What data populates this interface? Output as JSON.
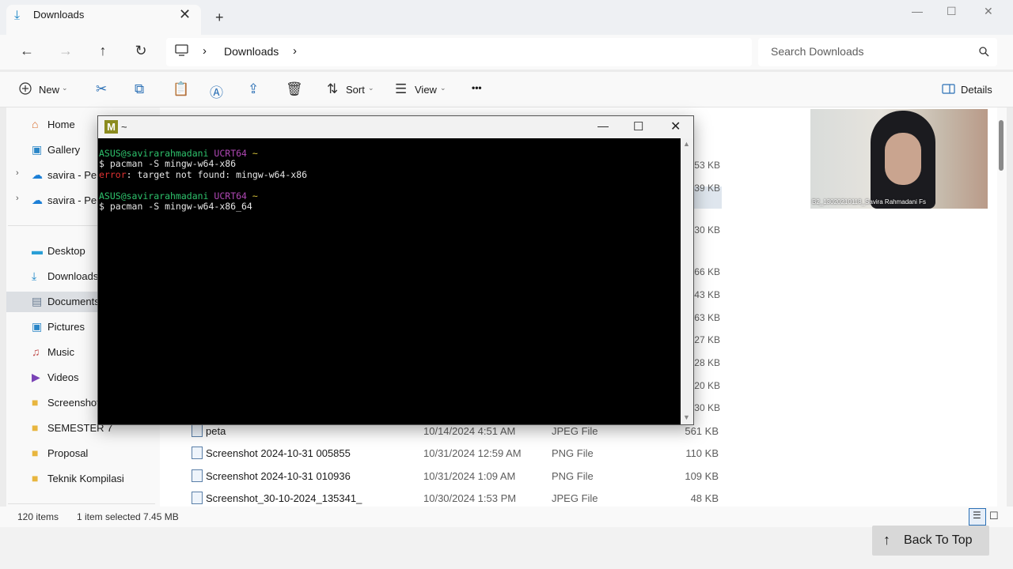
{
  "tab": {
    "title": "Downloads",
    "close": "✕",
    "add": "+"
  },
  "window_controls": {
    "minimize": "—",
    "maximize": "☐",
    "close": "✕"
  },
  "address": {
    "path_item": "Downloads",
    "sep1": "›",
    "sep2": "›"
  },
  "search": {
    "placeholder": "Search Downloads"
  },
  "toolbar": {
    "new_label": "New",
    "sort_label": "Sort",
    "view_label": "View",
    "details_label": "Details",
    "more": "•••"
  },
  "sidebar": {
    "items": [
      {
        "label": "Home"
      },
      {
        "label": "Gallery"
      },
      {
        "label": "savira - Pers"
      },
      {
        "label": "savira - Pers"
      },
      {
        "label": "Desktop"
      },
      {
        "label": "Downloads"
      },
      {
        "label": "Documents"
      },
      {
        "label": "Pictures"
      },
      {
        "label": "Music"
      },
      {
        "label": "Videos"
      },
      {
        "label": "Screenshots"
      },
      {
        "label": "SEMESTER 7"
      },
      {
        "label": "Proposal"
      },
      {
        "label": "Teknik Kompilasi"
      }
    ]
  },
  "partial_sizes": [
    "53 KB",
    "39 KB",
    "30 KB",
    "66 KB",
    "43 KB",
    "63 KB",
    "27 KB",
    "28 KB",
    "20 KB",
    "30 KB"
  ],
  "files": [
    {
      "name": "peta",
      "date": "10/14/2024 4:51 AM",
      "type": "JPEG File",
      "size": "561 KB"
    },
    {
      "name": "Screenshot 2024-10-31 005855",
      "date": "10/31/2024 12:59 AM",
      "type": "PNG File",
      "size": "110 KB"
    },
    {
      "name": "Screenshot 2024-10-31 010936",
      "date": "10/31/2024 1:09 AM",
      "type": "PNG File",
      "size": "109 KB"
    },
    {
      "name": "Screenshot_30-10-2024_135341_",
      "date": "10/30/2024 1:53 PM",
      "type": "JPEG File",
      "size": "48 KB"
    }
  ],
  "status": {
    "items": "120 items",
    "selected": "1 item selected  7.45 MB"
  },
  "back_to_top": "Back To Top",
  "terminal": {
    "title": "~",
    "prompt1": {
      "user": "ASUS@savirarahmadani",
      "env": "UCRT64",
      "dir": "~"
    },
    "cmd1": "$ pacman -S mingw-w64-x86",
    "error_label": "error",
    "error_msg": ": target not found: mingw-w64-x86",
    "prompt2": {
      "user": "ASUS@savirarahmadani",
      "env": "UCRT64",
      "dir": "~"
    },
    "cmd2": "$ pacman -S mingw-w64-x86_64"
  },
  "video": {
    "caption": "B2_13020210118_Savira Rahmadani Fs"
  }
}
